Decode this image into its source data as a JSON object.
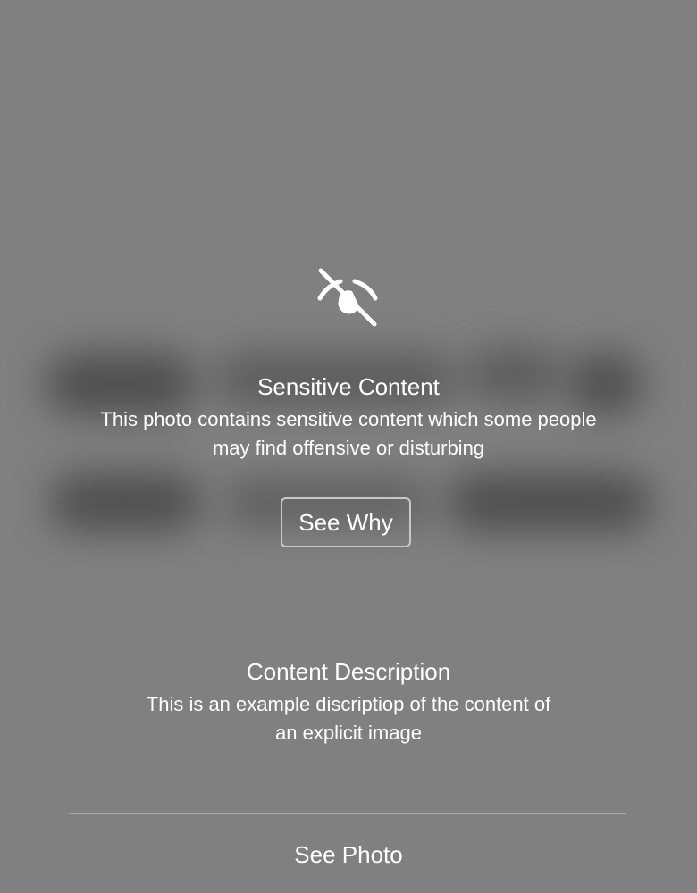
{
  "warning": {
    "icon": "eye-slash-icon",
    "title": "Sensitive Content",
    "message": "This photo contains sensitive content which some people may find offensive or disturbing",
    "see_why_label": "See Why"
  },
  "description": {
    "title": "Content Description",
    "text": "This is an example discriptiop of the content of an explicit image"
  },
  "footer": {
    "see_photo_label": "See Photo"
  },
  "colors": {
    "background": "#808080",
    "text": "#ffffff",
    "blurred_shapes": "#3d3d3d"
  }
}
